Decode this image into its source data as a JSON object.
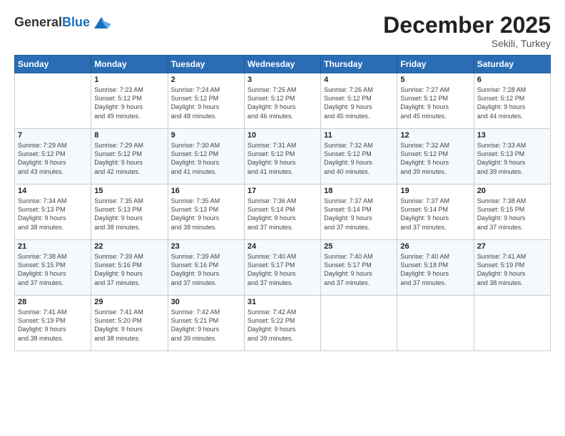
{
  "header": {
    "logo_line1": "General",
    "logo_line2": "Blue",
    "month_title": "December 2025",
    "location": "Sekili, Turkey"
  },
  "days_of_week": [
    "Sunday",
    "Monday",
    "Tuesday",
    "Wednesday",
    "Thursday",
    "Friday",
    "Saturday"
  ],
  "weeks": [
    [
      {
        "day": "",
        "info": ""
      },
      {
        "day": "1",
        "info": "Sunrise: 7:23 AM\nSunset: 5:12 PM\nDaylight: 9 hours\nand 49 minutes."
      },
      {
        "day": "2",
        "info": "Sunrise: 7:24 AM\nSunset: 5:12 PM\nDaylight: 9 hours\nand 48 minutes."
      },
      {
        "day": "3",
        "info": "Sunrise: 7:25 AM\nSunset: 5:12 PM\nDaylight: 9 hours\nand 46 minutes."
      },
      {
        "day": "4",
        "info": "Sunrise: 7:26 AM\nSunset: 5:12 PM\nDaylight: 9 hours\nand 45 minutes."
      },
      {
        "day": "5",
        "info": "Sunrise: 7:27 AM\nSunset: 5:12 PM\nDaylight: 9 hours\nand 45 minutes."
      },
      {
        "day": "6",
        "info": "Sunrise: 7:28 AM\nSunset: 5:12 PM\nDaylight: 9 hours\nand 44 minutes."
      }
    ],
    [
      {
        "day": "7",
        "info": "Sunrise: 7:29 AM\nSunset: 5:12 PM\nDaylight: 9 hours\nand 43 minutes."
      },
      {
        "day": "8",
        "info": "Sunrise: 7:29 AM\nSunset: 5:12 PM\nDaylight: 9 hours\nand 42 minutes."
      },
      {
        "day": "9",
        "info": "Sunrise: 7:30 AM\nSunset: 5:12 PM\nDaylight: 9 hours\nand 41 minutes."
      },
      {
        "day": "10",
        "info": "Sunrise: 7:31 AM\nSunset: 5:12 PM\nDaylight: 9 hours\nand 41 minutes."
      },
      {
        "day": "11",
        "info": "Sunrise: 7:32 AM\nSunset: 5:12 PM\nDaylight: 9 hours\nand 40 minutes."
      },
      {
        "day": "12",
        "info": "Sunrise: 7:32 AM\nSunset: 5:12 PM\nDaylight: 9 hours\nand 39 minutes."
      },
      {
        "day": "13",
        "info": "Sunrise: 7:33 AM\nSunset: 5:13 PM\nDaylight: 9 hours\nand 39 minutes."
      }
    ],
    [
      {
        "day": "14",
        "info": "Sunrise: 7:34 AM\nSunset: 5:13 PM\nDaylight: 9 hours\nand 38 minutes."
      },
      {
        "day": "15",
        "info": "Sunrise: 7:35 AM\nSunset: 5:13 PM\nDaylight: 9 hours\nand 38 minutes."
      },
      {
        "day": "16",
        "info": "Sunrise: 7:35 AM\nSunset: 5:13 PM\nDaylight: 9 hours\nand 38 minutes."
      },
      {
        "day": "17",
        "info": "Sunrise: 7:36 AM\nSunset: 5:14 PM\nDaylight: 9 hours\nand 37 minutes."
      },
      {
        "day": "18",
        "info": "Sunrise: 7:37 AM\nSunset: 5:14 PM\nDaylight: 9 hours\nand 37 minutes."
      },
      {
        "day": "19",
        "info": "Sunrise: 7:37 AM\nSunset: 5:14 PM\nDaylight: 9 hours\nand 37 minutes."
      },
      {
        "day": "20",
        "info": "Sunrise: 7:38 AM\nSunset: 5:15 PM\nDaylight: 9 hours\nand 37 minutes."
      }
    ],
    [
      {
        "day": "21",
        "info": "Sunrise: 7:38 AM\nSunset: 5:15 PM\nDaylight: 9 hours\nand 37 minutes."
      },
      {
        "day": "22",
        "info": "Sunrise: 7:39 AM\nSunset: 5:16 PM\nDaylight: 9 hours\nand 37 minutes."
      },
      {
        "day": "23",
        "info": "Sunrise: 7:39 AM\nSunset: 5:16 PM\nDaylight: 9 hours\nand 37 minutes."
      },
      {
        "day": "24",
        "info": "Sunrise: 7:40 AM\nSunset: 5:17 PM\nDaylight: 9 hours\nand 37 minutes."
      },
      {
        "day": "25",
        "info": "Sunrise: 7:40 AM\nSunset: 5:17 PM\nDaylight: 9 hours\nand 37 minutes."
      },
      {
        "day": "26",
        "info": "Sunrise: 7:40 AM\nSunset: 5:18 PM\nDaylight: 9 hours\nand 37 minutes."
      },
      {
        "day": "27",
        "info": "Sunrise: 7:41 AM\nSunset: 5:19 PM\nDaylight: 9 hours\nand 38 minutes."
      }
    ],
    [
      {
        "day": "28",
        "info": "Sunrise: 7:41 AM\nSunset: 5:19 PM\nDaylight: 9 hours\nand 38 minutes."
      },
      {
        "day": "29",
        "info": "Sunrise: 7:41 AM\nSunset: 5:20 PM\nDaylight: 9 hours\nand 38 minutes."
      },
      {
        "day": "30",
        "info": "Sunrise: 7:42 AM\nSunset: 5:21 PM\nDaylight: 9 hours\nand 39 minutes."
      },
      {
        "day": "31",
        "info": "Sunrise: 7:42 AM\nSunset: 5:22 PM\nDaylight: 9 hours\nand 39 minutes."
      },
      {
        "day": "",
        "info": ""
      },
      {
        "day": "",
        "info": ""
      },
      {
        "day": "",
        "info": ""
      }
    ]
  ]
}
